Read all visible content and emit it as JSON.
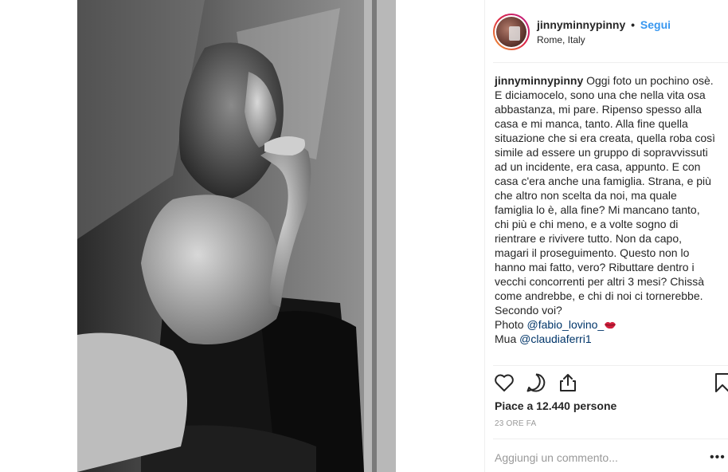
{
  "post": {
    "username": "jinnyminnypinny",
    "dot": "•",
    "follow_label": "Segui",
    "location": "Rome, Italy",
    "caption_user": "jinnyminnypinny",
    "caption_text": " Oggi foto un pochino osè. E diciamocelo, sono una che nella vita osa abbastanza, mi pare. Ripenso spesso alla casa e mi manca, tanto. Alla fine quella situazione che si era creata, quella roba così simile ad essere un gruppo di sopravvissuti ad un incidente, era casa, appunto. E con casa c'era anche una famiglia. Strana, e più che altro non scelta da noi, ma quale famiglia lo è, alla fine? Mi mancano tanto, chi più e chi meno, e a volte sogno di rientrare e rivivere tutto. Non da capo, magari il proseguimento. Questo non lo hanno mai fatto, vero? Ributtare dentro i vecchi concorrenti per altri 3 mesi? Chissà come andrebbe, e chi di noi ci tornerebbe. Secondo voi?",
    "photo_prefix": "Photo ",
    "photo_mention": "@fabio_lovino_",
    "mua_prefix": "Mua ",
    "mua_mention": "@claudiaferri1",
    "likes_text": "Piace a 12.440 persone",
    "time_text": "23 ORE FA",
    "comment_placeholder": "Aggiungi un commento...",
    "more_label": "•••"
  },
  "icons": {
    "like": "heart-icon",
    "comment": "comment-bubble-icon",
    "share": "share-icon",
    "save": "bookmark-icon",
    "lips": "kiss-lips-emoji"
  },
  "colors": {
    "follow": "#3897f0",
    "mention": "#003569",
    "muted": "#999999",
    "border": "#efefef"
  }
}
